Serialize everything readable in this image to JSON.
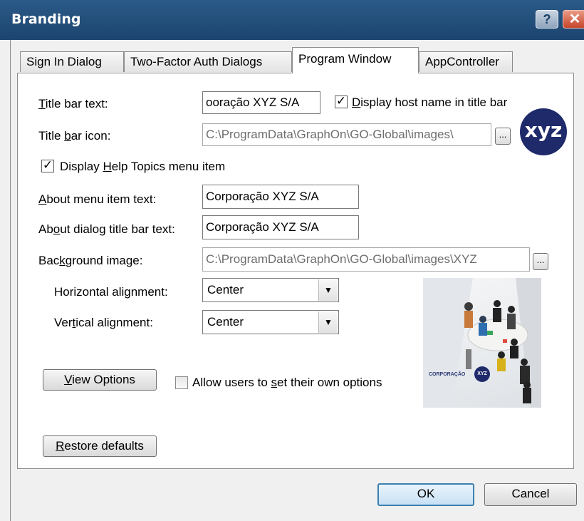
{
  "window": {
    "title": "Branding"
  },
  "titlebar_buttons": {
    "help": "?",
    "close": "✕"
  },
  "tabs": [
    {
      "label": "Sign In Dialog",
      "active": false
    },
    {
      "label": "Two-Factor Auth Dialogs",
      "active": false
    },
    {
      "label": "Program Window",
      "active": true
    },
    {
      "label": "AppController",
      "active": false
    }
  ],
  "form": {
    "title_bar_text": {
      "label_u": "T",
      "label_rest": "itle bar text:",
      "value": "ooração XYZ S/A"
    },
    "display_host_name": {
      "checked": true,
      "label_u": "D",
      "label_rest": "isplay host name in title bar"
    },
    "title_bar_icon": {
      "label_pre": "Title ",
      "label_u": "b",
      "label_rest": "ar icon:",
      "value": "C:\\ProgramData\\GraphOn\\GO-Global\\images\\"
    },
    "display_help_topics": {
      "checked": true,
      "label_pre": "Display ",
      "label_u": "H",
      "label_rest": "elp Topics menu item"
    },
    "about_menu_item_text": {
      "label_u": "A",
      "label_rest": "bout menu item text:",
      "value": "Corporação XYZ S/A"
    },
    "about_dialog_title_bar_text": {
      "label_pre": "Ab",
      "label_u": "o",
      "label_rest": "ut dialog title bar text:",
      "value": "Corporação XYZ S/A"
    },
    "background_image": {
      "label_pre": "Bac",
      "label_u": "k",
      "label_rest": "ground image:",
      "value": "C:\\ProgramData\\GraphOn\\GO-Global\\images\\XYZ"
    },
    "horizontal_alignment": {
      "label_pre": "Horizontal alignment:",
      "value": "Center"
    },
    "vertical_alignment": {
      "label_pre": "Ver",
      "label_u": "t",
      "label_rest": "ical alignment:",
      "value": "Center"
    },
    "browse_label": "...",
    "view_options": {
      "label_u": "V",
      "label_rest": "iew Options"
    },
    "allow_users": {
      "checked": false,
      "label_pre": "Allow users to ",
      "label_u": "s",
      "label_rest": "et their own options"
    },
    "restore_defaults": {
      "label_u": "R",
      "label_rest": "estore defaults"
    }
  },
  "logo": {
    "text": "xyz",
    "color": "#1f2a6b"
  },
  "preview": {
    "brand_text": "CORPORAÇÃO",
    "badge_text": "XYZ"
  },
  "footer": {
    "ok": "OK",
    "cancel": "Cancel"
  },
  "colors": {
    "titlebar": "#24507c",
    "primary_border": "#3c7fb1"
  }
}
